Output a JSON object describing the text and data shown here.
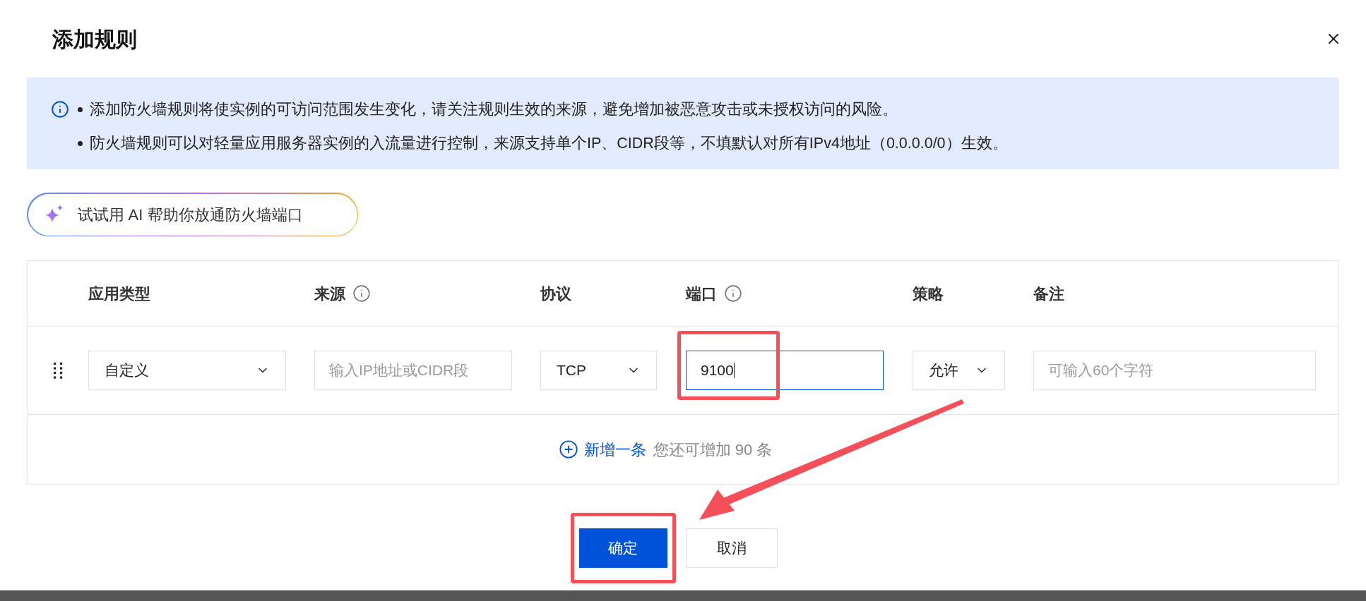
{
  "dialog": {
    "title": "添加规则"
  },
  "notice": {
    "items": [
      "添加防火墙规则将使实例的可访问范围发生变化，请关注规则生效的来源，避免增加被恶意攻击或未授权访问的风险。",
      "防火墙规则可以对轻量应用服务器实例的入流量进行控制，来源支持单个IP、CIDR段等，不填默认对所有IPv4地址（0.0.0.0/0）生效。"
    ]
  },
  "ai_button": {
    "label": "试试用 AI 帮助你放通防火墙端口"
  },
  "table": {
    "columns": [
      {
        "label": "应用类型",
        "info": false
      },
      {
        "label": "来源",
        "info": true
      },
      {
        "label": "协议",
        "info": false
      },
      {
        "label": "端口",
        "info": true
      },
      {
        "label": "策略",
        "info": false
      },
      {
        "label": "备注",
        "info": false
      }
    ],
    "rows": [
      {
        "cells": [
          {
            "kind": "select",
            "value": "自定义",
            "highlighted": false
          },
          {
            "kind": "input",
            "placeholder": "输入IP地址或CIDR段",
            "focused": false,
            "highlighted": false
          },
          {
            "kind": "select",
            "value": "TCP",
            "highlighted": false
          },
          {
            "kind": "input",
            "value": "9100",
            "focused": true,
            "highlighted": true
          },
          {
            "kind": "select",
            "value": "允许",
            "highlighted": false
          },
          {
            "kind": "input",
            "placeholder": "可输入60个字符",
            "focused": false,
            "highlighted": false
          }
        ]
      }
    ],
    "add_row": {
      "label": "新增一条",
      "hint": "您还可增加 90 条"
    }
  },
  "footer": {
    "buttons": [
      {
        "label": "确定",
        "primary": true,
        "highlighted": true
      },
      {
        "label": "取消",
        "primary": false,
        "highlighted": false
      }
    ]
  }
}
